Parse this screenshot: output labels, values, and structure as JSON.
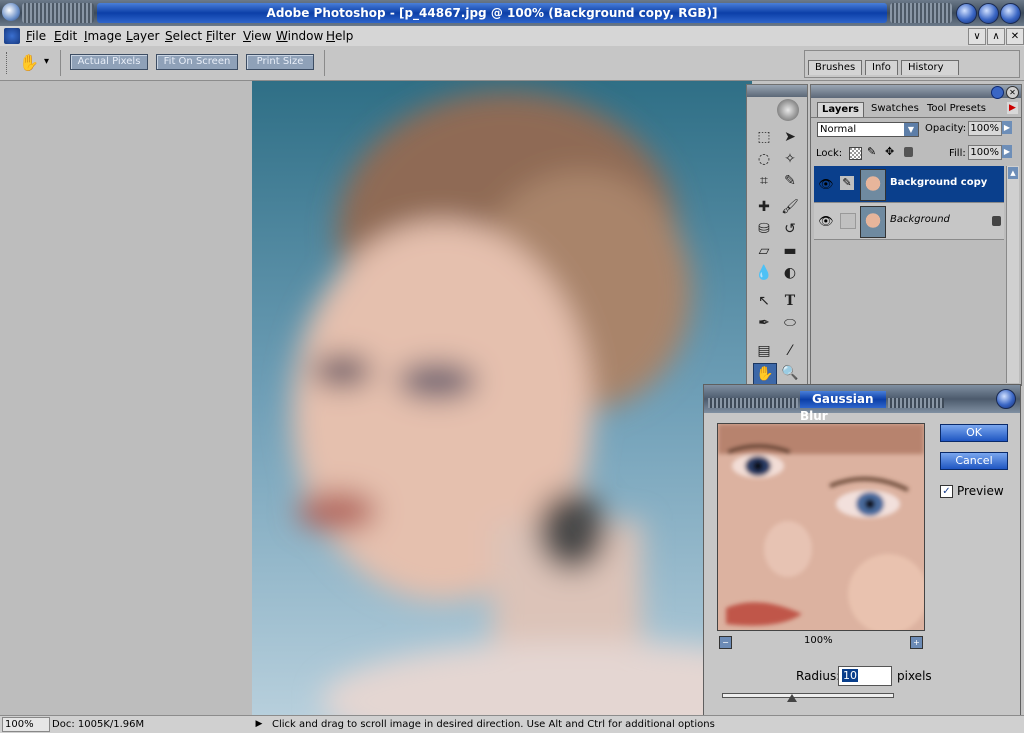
{
  "window": {
    "title": "Adobe Photoshop - [p_44867.jpg @ 100% (Background copy, RGB)]"
  },
  "menu": {
    "items": [
      "File",
      "Edit",
      "Image",
      "Layer",
      "Select",
      "Filter",
      "View",
      "Window",
      "Help"
    ],
    "mdi_buttons": [
      "∨",
      "∧",
      "✕"
    ]
  },
  "options": {
    "buttons": [
      "Actual Pixels",
      "Fit On Screen",
      "Print Size"
    ],
    "tool_arrow": "▾"
  },
  "palette_well": {
    "tabs": [
      "Brushes",
      "Info",
      "History"
    ]
  },
  "layers_panel": {
    "tabs": [
      "Layers",
      "Swatches",
      "Tool Presets"
    ],
    "blend_mode": "Normal",
    "opacity_label": "Opacity:",
    "opacity_value": "100%",
    "lock_label": "Lock:",
    "fill_label": "Fill:",
    "fill_value": "100%",
    "layers": [
      {
        "name": "Background copy",
        "selected": true
      },
      {
        "name": "Background",
        "selected": false
      }
    ]
  },
  "dialog": {
    "title": "Gaussian Blur",
    "ok_label": "OK",
    "cancel_label": "Cancel",
    "preview_label": "Preview",
    "preview_checked": true,
    "zoom": "100%",
    "radius_label": "Radius:",
    "radius_value": "10",
    "radius_unit": "pixels",
    "slider_fraction": 0.41
  },
  "statusbar": {
    "zoom": "100%",
    "doc": "Doc: 1005K/1.96M",
    "message": "Click and drag to scroll image in desired direction.  Use Alt and Ctrl for additional options"
  },
  "colors": {
    "title_blue": "#0c3fa8",
    "selected_layer": "#0a3f8c",
    "workspace_gray": "#bdbdbd"
  }
}
